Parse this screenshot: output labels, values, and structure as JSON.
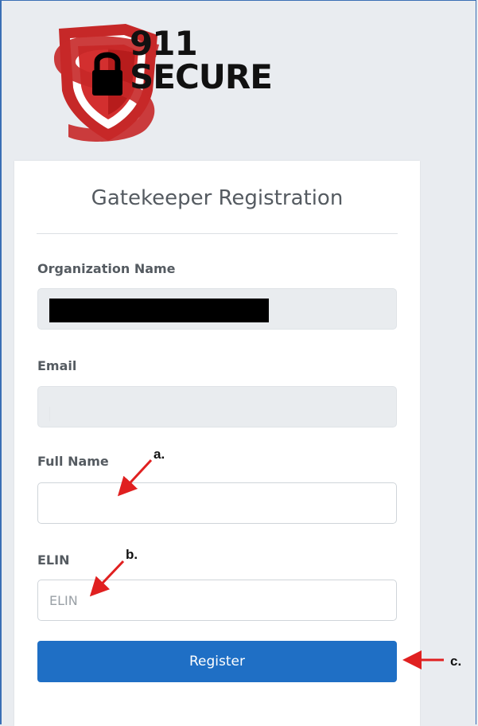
{
  "brand": {
    "line1": "911",
    "line2": "SECURE",
    "primary_color": "#d32f2f"
  },
  "form": {
    "title": "Gatekeeper Registration",
    "org_label": "Organization Name",
    "org_value": "",
    "email_label": "Email",
    "email_value": "",
    "fullname_label": "Full Name",
    "fullname_value": "",
    "elin_label": "ELIN",
    "elin_placeholder": "ELIN",
    "register_label": "Register",
    "button_color": "#1f6fc5"
  },
  "annotations": {
    "a": "a.",
    "b": "b.",
    "c": "c.",
    "arrow_color": "#e02020"
  }
}
